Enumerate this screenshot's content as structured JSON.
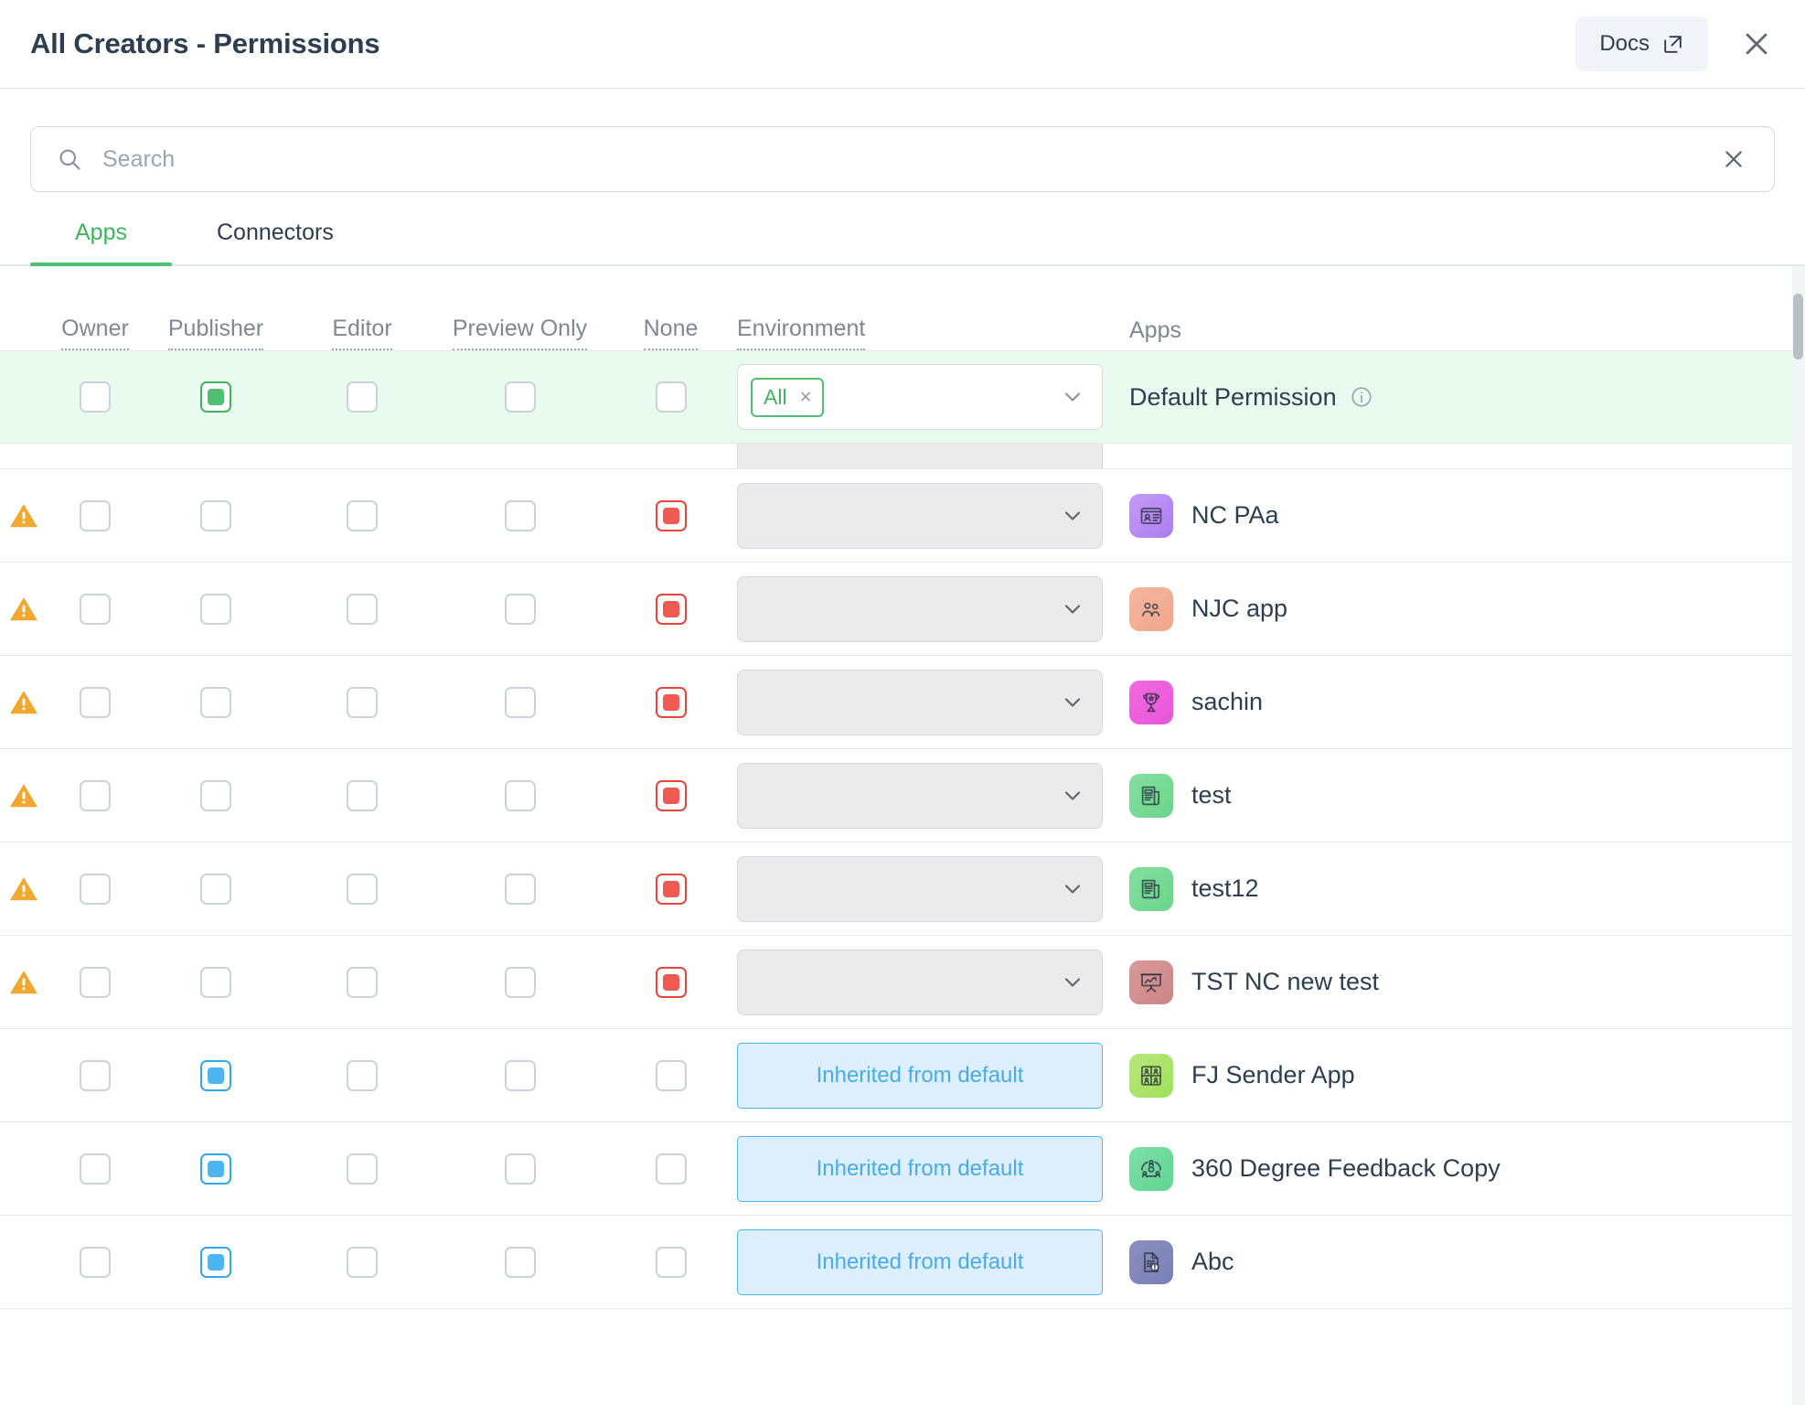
{
  "header": {
    "title": "All Creators - Permissions",
    "docs_label": "Docs",
    "close_label": "×"
  },
  "search": {
    "placeholder": "Search",
    "value": ""
  },
  "tabs": [
    {
      "label": "Apps",
      "active": true
    },
    {
      "label": "Connectors",
      "active": false
    }
  ],
  "columns": [
    {
      "label": "Owner",
      "underline": true
    },
    {
      "label": "Publisher",
      "underline": true
    },
    {
      "label": "Editor",
      "underline": true
    },
    {
      "label": "Preview Only",
      "underline": true
    },
    {
      "label": "None",
      "underline": true
    },
    {
      "label": "Environment",
      "underline": true
    },
    {
      "label": "Apps",
      "underline": false
    }
  ],
  "default_row": {
    "label": "Default Permission",
    "owner": false,
    "publisher": true,
    "editor": false,
    "preview_only": false,
    "none": false,
    "environment_chip": "All",
    "chip_remove": "×",
    "info_tooltip": "i"
  },
  "inherited_label": "Inherited from default",
  "colors": {
    "accent_green": "#4ec06f",
    "checked_red": "#ef5a52",
    "checked_blue": "#4db6f0",
    "highlight_row": "#e9faef",
    "warning": "#f0a830",
    "title": "#2c3e50"
  },
  "rows": [
    {
      "warning": true,
      "app": "NC PAa",
      "icon": "id-card-icon",
      "icon_color_a": "#c79af5",
      "icon_color_b": "#a97ef0",
      "owner": false,
      "publisher": false,
      "editor": false,
      "preview_only": false,
      "none": true,
      "env_state": "disabled",
      "env_text": ""
    },
    {
      "warning": true,
      "app": "NJC app",
      "icon": "people-icon",
      "icon_color_a": "#f5b7a0",
      "icon_color_b": "#f0a58c",
      "owner": false,
      "publisher": false,
      "editor": false,
      "preview_only": false,
      "none": true,
      "env_state": "disabled",
      "env_text": ""
    },
    {
      "warning": true,
      "app": "sachin",
      "icon": "trophy-icon",
      "icon_color_a": "#f06ae0",
      "icon_color_b": "#e855d8",
      "owner": false,
      "publisher": false,
      "editor": false,
      "preview_only": false,
      "none": true,
      "env_state": "disabled",
      "env_text": ""
    },
    {
      "warning": true,
      "app": "test",
      "icon": "newspaper-icon",
      "icon_color_a": "#84e0a0",
      "icon_color_b": "#6ad48b",
      "owner": false,
      "publisher": false,
      "editor": false,
      "preview_only": false,
      "none": true,
      "env_state": "disabled",
      "env_text": ""
    },
    {
      "warning": true,
      "app": "test12",
      "icon": "newspaper-icon",
      "icon_color_a": "#84e0a0",
      "icon_color_b": "#6ad48b",
      "owner": false,
      "publisher": false,
      "editor": false,
      "preview_only": false,
      "none": true,
      "env_state": "disabled",
      "env_text": ""
    },
    {
      "warning": true,
      "app": "TST NC new test",
      "icon": "presentation-icon",
      "icon_color_a": "#d99a9a",
      "icon_color_b": "#cc8585",
      "owner": false,
      "publisher": false,
      "editor": false,
      "preview_only": false,
      "none": true,
      "env_state": "disabled",
      "env_text": ""
    },
    {
      "warning": false,
      "app": "FJ Sender App",
      "icon": "grid-people-icon",
      "icon_color_a": "#b8e87a",
      "icon_color_b": "#9fe05c",
      "owner": false,
      "publisher": true,
      "editor": false,
      "preview_only": false,
      "none": false,
      "env_state": "inherited",
      "env_text": "Inherited from default"
    },
    {
      "warning": false,
      "app": "360 Degree Feedback Copy",
      "icon": "feedback-cycle-icon",
      "icon_color_a": "#7ee0a8",
      "icon_color_b": "#5fd491",
      "owner": false,
      "publisher": true,
      "editor": false,
      "preview_only": false,
      "none": false,
      "env_state": "inherited",
      "env_text": "Inherited from default"
    },
    {
      "warning": false,
      "app": "Abc",
      "icon": "document-alert-icon",
      "icon_color_a": "#8a8fc0",
      "icon_color_b": "#7a80b5",
      "owner": false,
      "publisher": true,
      "editor": false,
      "preview_only": false,
      "none": false,
      "env_state": "inherited",
      "env_text": "Inherited from default"
    }
  ]
}
